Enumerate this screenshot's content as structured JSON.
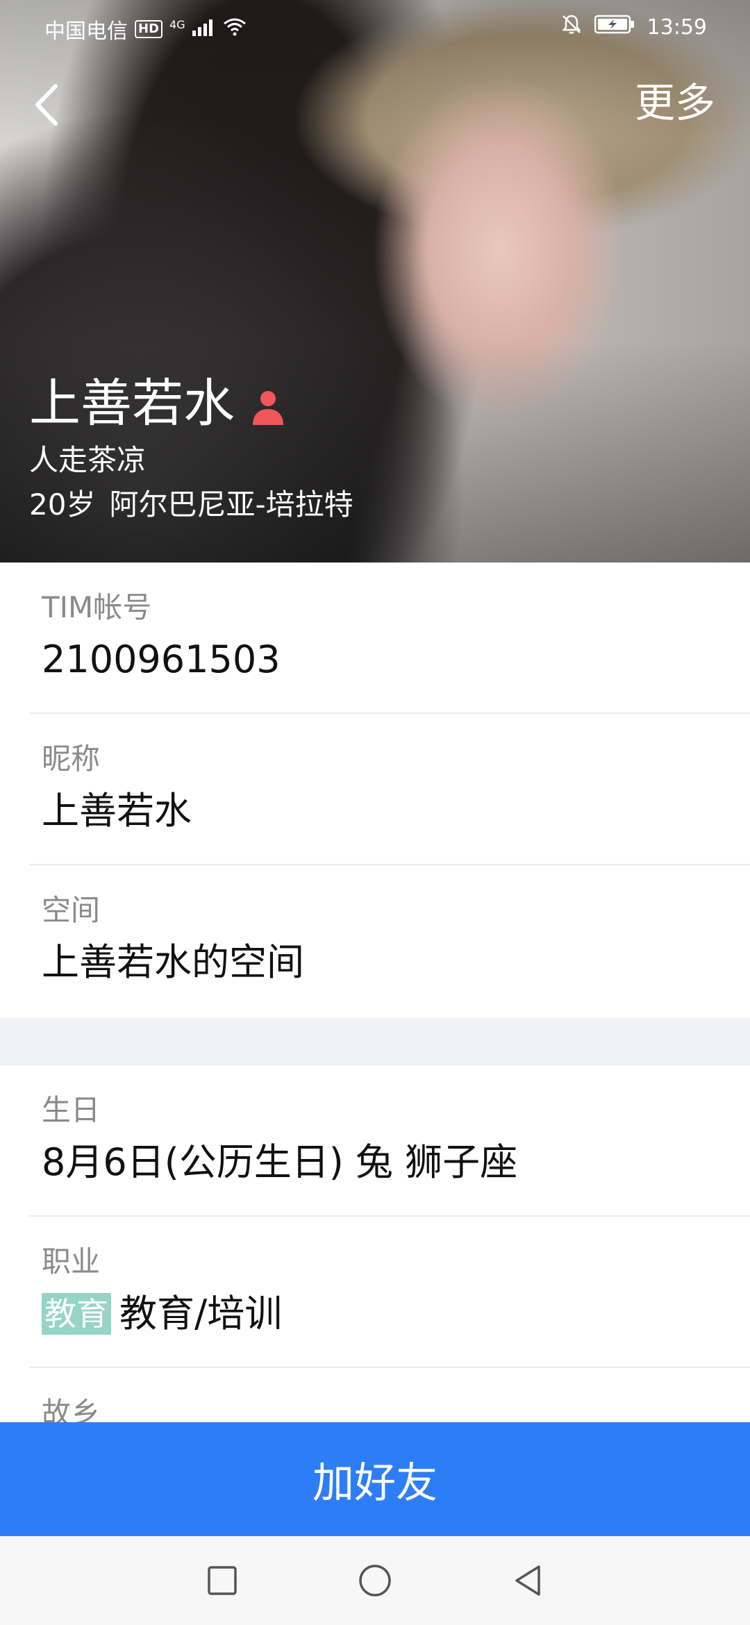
{
  "status_bar": {
    "carrier": "中国电信",
    "hd": "HD",
    "network": "4G",
    "time": "13:59"
  },
  "nav": {
    "more_label": "更多"
  },
  "profile": {
    "name": "上善若水",
    "signature": "人走茶凉",
    "age": "20岁",
    "location": "阿尔巴尼亚-培拉特"
  },
  "info": {
    "account": {
      "label": "TIM帐号",
      "value": "2100961503"
    },
    "nickname": {
      "label": "昵称",
      "value": "上善若水"
    },
    "space": {
      "label": "空间",
      "value": "上善若水的空间"
    },
    "birthday": {
      "label": "生日",
      "value": "8月6日(公历生日) 兔 狮子座"
    },
    "job": {
      "label": "职业",
      "badge": "教育",
      "value": "教育/培训"
    },
    "hometown": {
      "label": "故乡"
    }
  },
  "actions": {
    "add_friend_label": "加好友"
  },
  "colors": {
    "accent_blue": "#2d7ef6",
    "job_badge": "#96d4c6",
    "person_icon": "#f0575a"
  }
}
